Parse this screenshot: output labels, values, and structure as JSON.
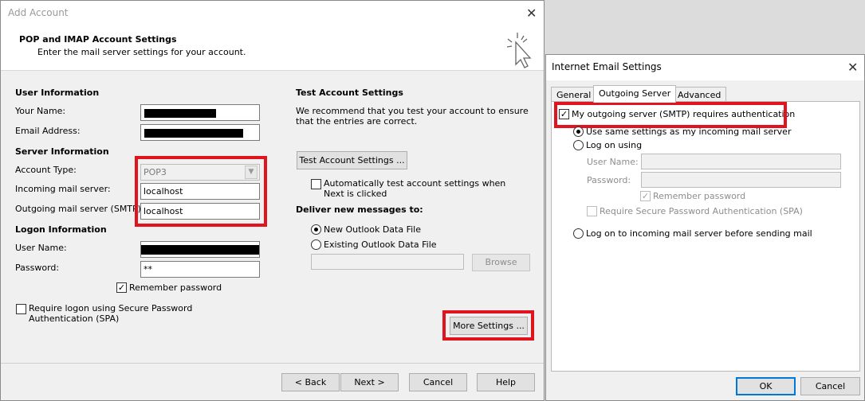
{
  "add_account": {
    "title": "Add Account",
    "heading": "POP and IMAP Account Settings",
    "subheading": "Enter the mail server settings for your account.",
    "user_info": {
      "section": "User Information",
      "name_label": "Your Name:",
      "email_label": "Email Address:"
    },
    "server_info": {
      "section": "Server Information",
      "account_type_label": "Account Type:",
      "account_type_value": "POP3",
      "incoming_label": "Incoming mail server:",
      "incoming_value": "localhost",
      "outgoing_label": "Outgoing mail server (SMTP):",
      "outgoing_value": "localhost"
    },
    "logon_info": {
      "section": "Logon Information",
      "user_name_label": "User Name:",
      "password_label": "Password:",
      "password_value": "**",
      "remember_password": "Remember password",
      "spa_label": "Require logon using Secure Password Authentication (SPA)"
    },
    "test": {
      "section": "Test Account Settings",
      "description": "We recommend that you test your account to ensure that the entries are correct.",
      "test_button": "Test Account Settings ...",
      "auto_test_label": "Automatically test account settings when Next is clicked",
      "deliver_label": "Deliver new messages to:",
      "new_file_label": "New Outlook Data File",
      "existing_file_label": "Existing Outlook Data File",
      "browse_button": "Browse",
      "more_settings_button": "More Settings ..."
    },
    "footer": {
      "back": "< Back",
      "next": "Next >",
      "cancel": "Cancel",
      "help": "Help"
    }
  },
  "internet_email_settings": {
    "title": "Internet Email Settings",
    "tabs": [
      "General",
      "Outgoing Server",
      "Advanced"
    ],
    "active_tab": "Outgoing Server",
    "requires_auth_label": "My outgoing server (SMTP) requires authentication",
    "same_settings_label": "Use same settings as my incoming mail server",
    "log_on_using_label": "Log on using",
    "user_name_label": "User Name:",
    "password_label": "Password:",
    "remember_password": "Remember password",
    "spa_label": "Require Secure Password Authentication (SPA)",
    "log_on_incoming_label": "Log on to incoming mail server before sending mail",
    "ok": "OK",
    "cancel": "Cancel"
  },
  "icons": {
    "close": "close-icon",
    "cursor": "cursor-click-icon",
    "dropdown": "chevron-down-icon"
  },
  "colors": {
    "highlight": "#e0141e",
    "dialog_bg": "#f0f0f0"
  }
}
